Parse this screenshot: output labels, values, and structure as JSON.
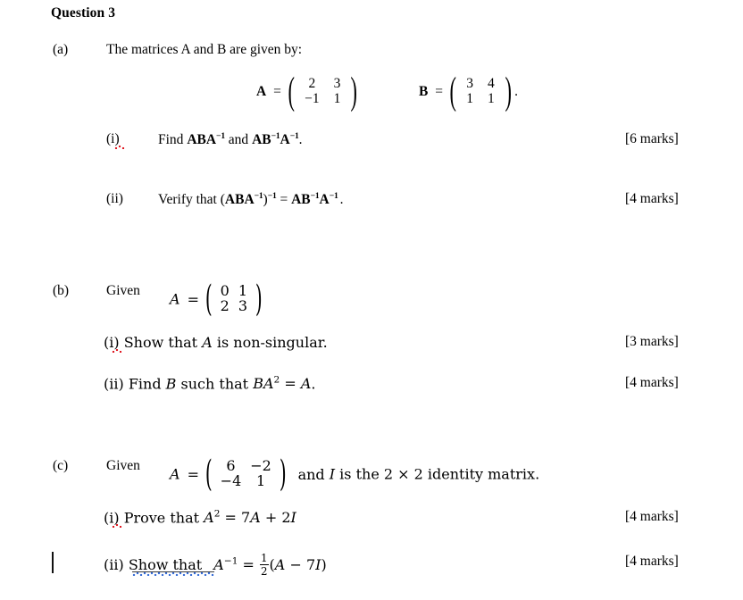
{
  "document": {
    "title": "Question 3",
    "page_background": "#ffffff",
    "text_color": "#000000"
  },
  "parts": {
    "a": {
      "label": "(a)",
      "stem": "The matrices A and B are given by:",
      "matrix_a": {
        "name": "A",
        "equals": "=",
        "rows": [
          [
            "2",
            "3"
          ],
          [
            "−1",
            "1"
          ]
        ]
      },
      "matrix_b": {
        "name": "B",
        "equals": "=",
        "rows": [
          [
            "3",
            "4"
          ],
          [
            "1",
            "1"
          ]
        ],
        "trailing": "."
      },
      "items": [
        {
          "label": "(i)",
          "text_before": "Find",
          "expr1_base": "ABA",
          "expr1_sup": "−1",
          "conjunction": "and",
          "expr2_a": "AB",
          "expr2_sup1": "−1",
          "expr2_b": "A",
          "expr2_sup2": "−1",
          "trailing": ".",
          "marks": "[6 marks]"
        },
        {
          "label": "(ii)",
          "text_before": "Verify that",
          "lhs_open": "(",
          "lhs_base": "ABA",
          "lhs_sup_inner": "−1",
          "lhs_close": ")",
          "lhs_sup_outer": "−1",
          "equals": "=",
          "rhs_a": "AB",
          "rhs_sup1": "−1",
          "rhs_b": "A",
          "rhs_sup2": "−1",
          "trailing": ".",
          "marks": "[4 marks]"
        }
      ]
    },
    "b": {
      "label": "(b)",
      "stem": "Given",
      "matrix": {
        "name": "A",
        "equals": "=",
        "rows": [
          [
            "0",
            "1"
          ],
          [
            "2",
            "3"
          ]
        ]
      },
      "items": [
        {
          "label": "(i)",
          "text_a": "Show that",
          "var": "A",
          "text_b": "is non-singular.",
          "marks": "[3 marks]"
        },
        {
          "label": "(ii)",
          "text_a": "Find",
          "var1": "B",
          "text_b": "such that",
          "expr_b": "B",
          "expr_a": "A",
          "expr_sup": "2",
          "equals": "=",
          "expr_rhs": "A",
          "trailing": ".",
          "marks": "[4 marks]"
        }
      ]
    },
    "c": {
      "label": "(c)",
      "stem": "Given",
      "matrix": {
        "name": "A",
        "equals": "=",
        "rows": [
          [
            "6",
            "−2"
          ],
          [
            "−4",
            "1"
          ]
        ]
      },
      "stem_tail_a": "and",
      "stem_tail_var": "I",
      "stem_tail_b": "is the 2 × 2 identity matrix.",
      "items": [
        {
          "label": "(i)",
          "text": "Prove that",
          "lhs_var": "A",
          "lhs_sup": "2",
          "equals": "=",
          "rhs_coef1": "7",
          "rhs_var1": "A",
          "plus": "+",
          "rhs_coef2": "2",
          "rhs_var2": "I",
          "marks": "[4 marks]"
        },
        {
          "label": "(ii)",
          "text": "Show that",
          "lhs_var": "A",
          "lhs_sup": "−1",
          "equals": "=",
          "frac_num": "1",
          "frac_den": "2",
          "open": "(",
          "rhs_var1": "A",
          "minus": "−",
          "rhs_coef": "7",
          "rhs_var2": "I",
          "close": ")",
          "marks": "[4 marks]"
        }
      ]
    }
  },
  "proofing": {
    "spelling_color": "#e01b24",
    "grammar_color": "#3a6fd8",
    "change_bar_color": "#111111"
  }
}
